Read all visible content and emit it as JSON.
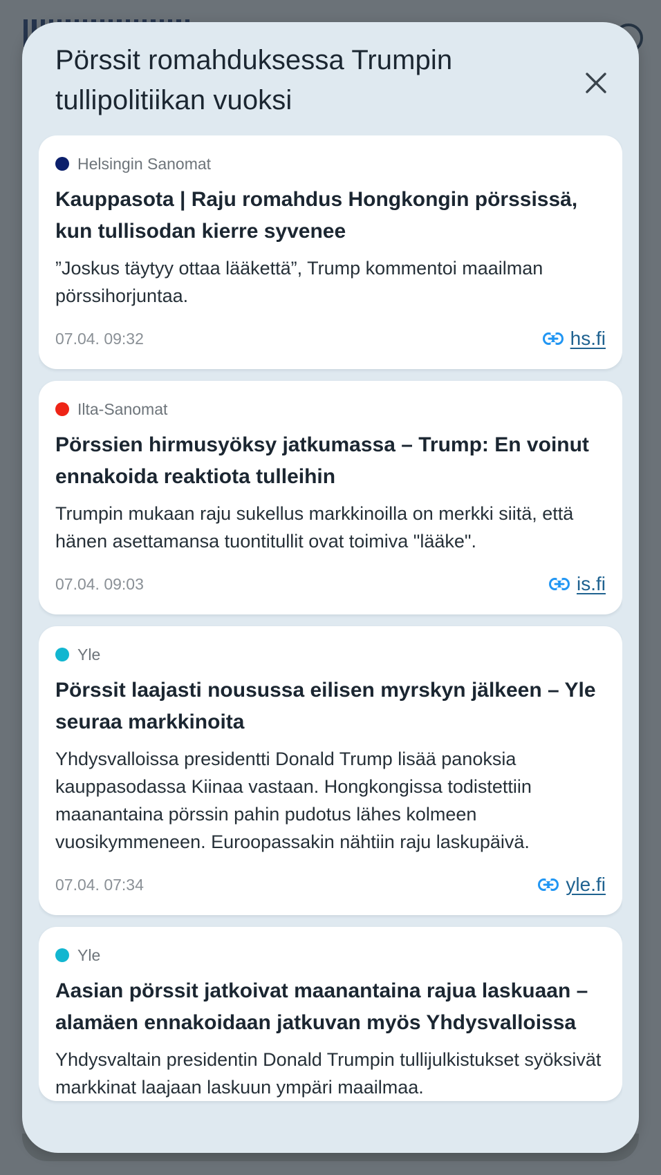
{
  "sheet": {
    "title": "Pörssit romahduksessa Trumpin tullipolitiikan vuoksi",
    "close_icon": "close-icon"
  },
  "articles": [
    {
      "source": "Helsingin Sanomat",
      "source_color": "#0b1f6b",
      "headline": "Kauppasota | Raju romahdus Hongkongin pörssissä, kun tullisodan kierre syvenee",
      "summary": "”Joskus täytyy ottaa lääkettä”, Trump kommentoi maailman pörssihorjuntaa.",
      "time": "07.04. 09:32",
      "link_icon": "link-icon",
      "domain": "hs.fi"
    },
    {
      "source": "Ilta-Sanomat",
      "source_color": "#ee2416",
      "headline": "Pörssien hirmusyöksy jatkumassa – Trump: En voinut ennakoida reaktiota tulleihin",
      "summary": "Trumpin mukaan raju sukellus markkinoilla on merkki siitä, että hänen asettamansa tuontitullit ovat toimiva \"lääke\".",
      "time": "07.04. 09:03",
      "link_icon": "link-icon",
      "domain": "is.fi"
    },
    {
      "source": "Yle",
      "source_color": "#12b6d0",
      "headline": "Pörssit laajasti nousussa eilisen myrskyn jälkeen – Yle seuraa markkinoita",
      "summary": "Yhdysvalloissa presidentti Donald Trump lisää panoksia kauppasodassa Kiinaa vastaan. Hongkongissa todistettiin maanantaina pörssin pahin pudotus lähes kolmeen vuosikymmeneen. Euroopassakin nähtiin raju laskupäivä.",
      "time": "07.04. 07:34",
      "link_icon": "link-icon",
      "domain": "yle.fi"
    },
    {
      "source": "Yle",
      "source_color": "#12b6d0",
      "headline": "Aasian pörssit jatkoivat maanantaina rajua laskuaan – alamäen ennakoidaan jatkuvan myös Yhdysvalloissa",
      "summary": "Yhdysvaltain presidentin Donald Trumpin tullijulkistukset syöksivät markkinat laajaan laskuun ympäri maailmaa.",
      "time": "",
      "link_icon": "link-icon",
      "domain": ""
    }
  ]
}
